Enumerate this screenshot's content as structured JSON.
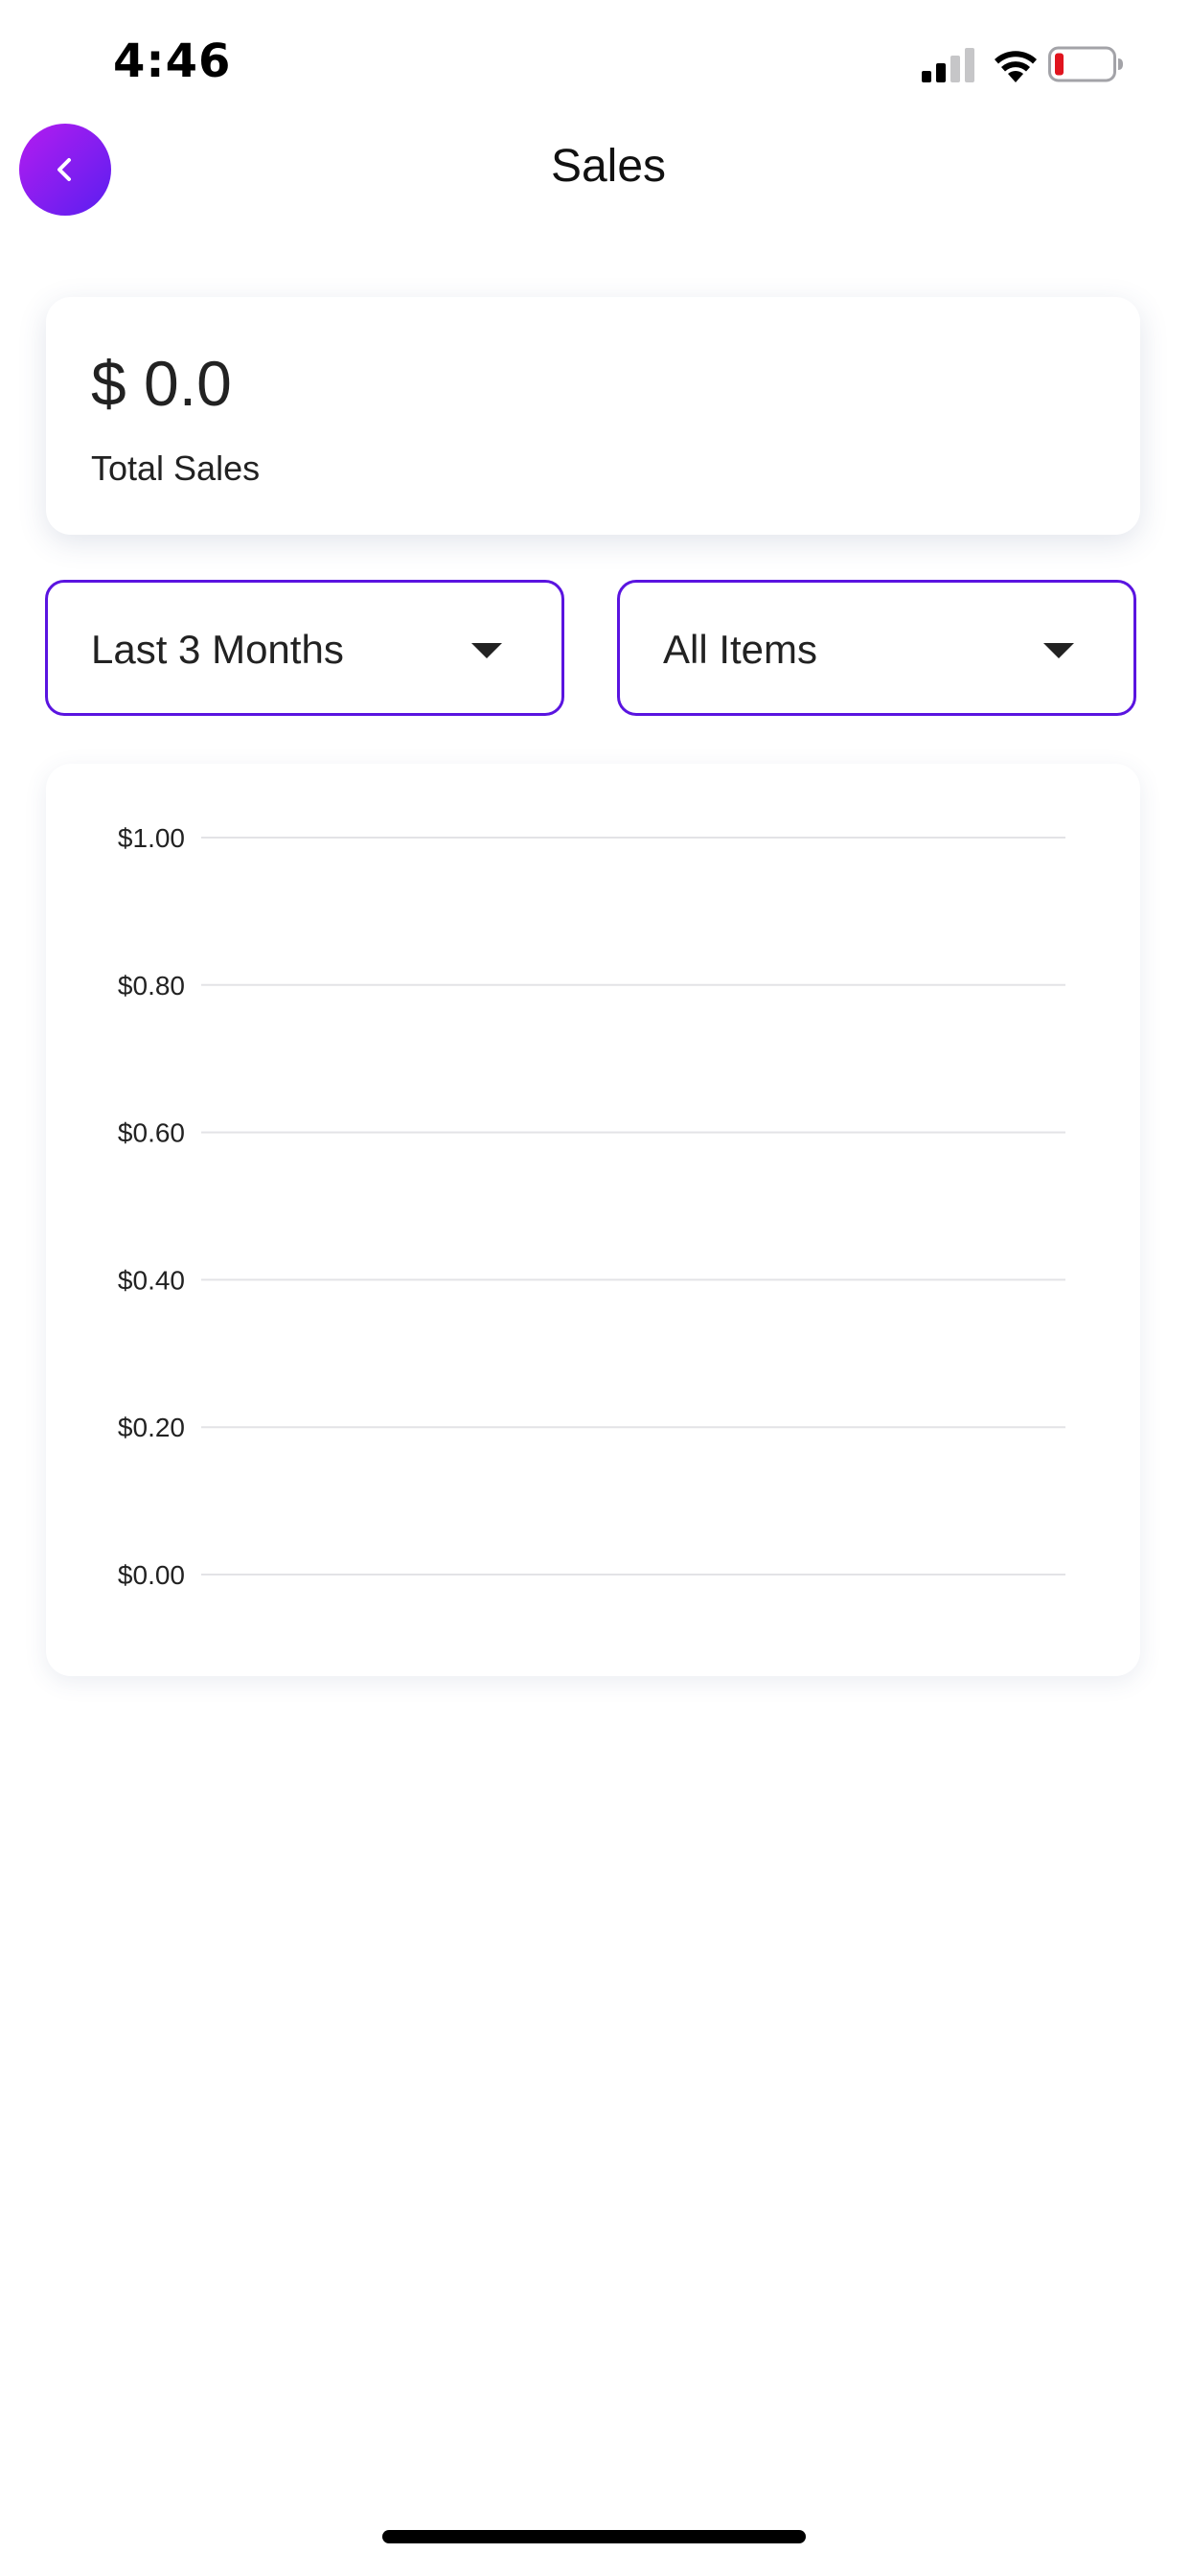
{
  "status_bar": {
    "time": "4:46",
    "icons": [
      "cellular-signal-icon",
      "wifi-icon",
      "battery-low-icon"
    ],
    "battery_color": "#e0141e"
  },
  "header": {
    "title": "Sales",
    "back_icon": "chevron-left-icon",
    "accent_gradient": [
      "#b41cf0",
      "#5a1ff0"
    ]
  },
  "summary": {
    "amount": "$ 0.0",
    "label": "Total Sales"
  },
  "filters": {
    "period": {
      "selected": "Last 3 Months"
    },
    "items": {
      "selected": "All Items"
    },
    "border_color": "#5a14e0"
  },
  "chart_data": {
    "type": "bar",
    "categories": [],
    "values": [],
    "title": "",
    "xlabel": "",
    "ylabel": "",
    "ylim": [
      0,
      1
    ],
    "yticks": [
      1.0,
      0.8,
      0.6,
      0.4,
      0.2,
      0.0
    ],
    "ytick_labels": [
      "$1.00",
      "$0.80",
      "$0.60",
      "$0.40",
      "$0.20",
      "$0.00"
    ],
    "grid": true
  }
}
